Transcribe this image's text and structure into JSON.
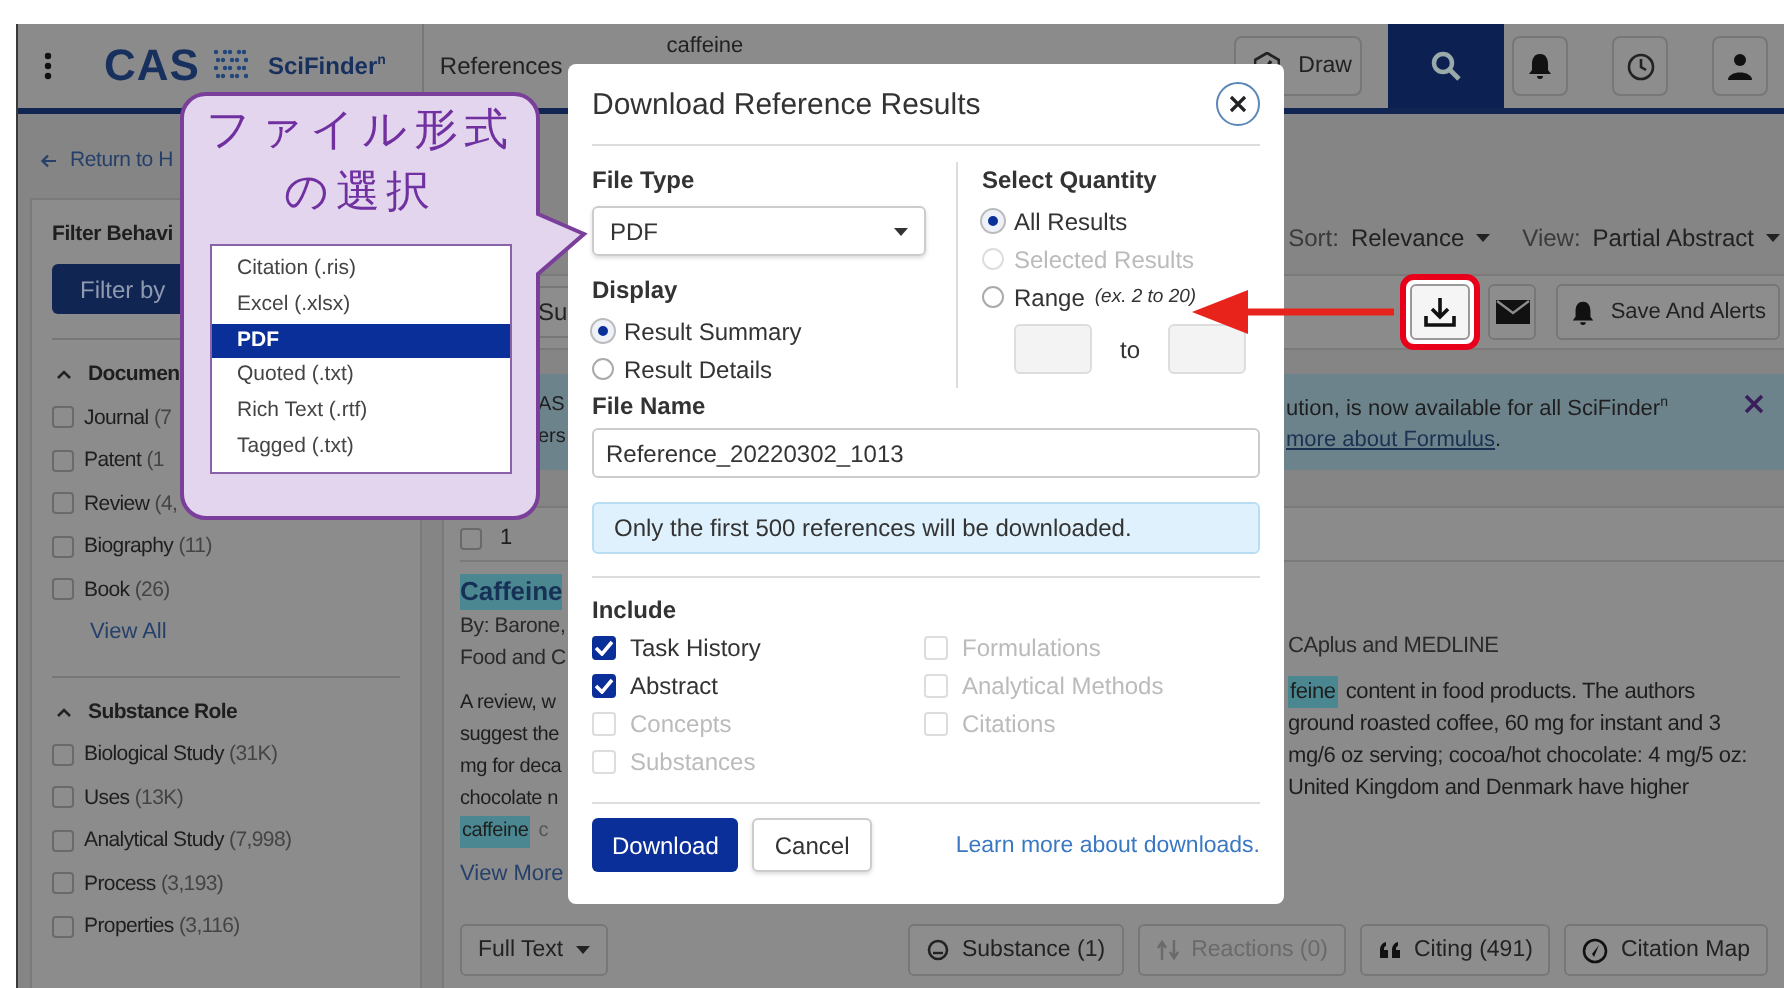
{
  "top_bar": {
    "logo": "CAS",
    "product": "SciFinder$^{n}$",
    "search_type": "References",
    "search_query": "caffeine",
    "draw_button": "Draw"
  },
  "back_link": "Return to H",
  "filter_panel": {
    "title": "Filter Behavi",
    "filter_button": "Filter by",
    "sections": [
      {
        "title": "Documen",
        "expanded": true,
        "items": [
          {
            "label": "Journal",
            "count": "(7",
            "checked": false
          },
          {
            "label": "Patent",
            "count": "(1",
            "checked": false
          },
          {
            "label": "Review",
            "count": "(4,",
            "checked": false
          },
          {
            "label": "Biography",
            "count": "(11)",
            "checked": false
          },
          {
            "label": "Book",
            "count": "(26)",
            "checked": false
          }
        ],
        "view_all": "View All"
      },
      {
        "title": "Substance Role",
        "expanded": true,
        "items": [
          {
            "label": "Biological Study",
            "count": "(31K)",
            "checked": false
          },
          {
            "label": "Uses",
            "count": "(13K)",
            "checked": false
          },
          {
            "label": "Analytical Study",
            "count": "(7,998)",
            "checked": false
          },
          {
            "label": "Process",
            "count": "(3,193)",
            "checked": false
          },
          {
            "label": "Properties",
            "count": "(3,116)",
            "checked": false
          }
        ]
      }
    ]
  },
  "results": {
    "sort_label": "Sort:",
    "sort_value": "Relevance",
    "view_label": "View:",
    "view_value": "Partial Abstract",
    "toolbar_fragment": "Su",
    "save_alerts": "Save And Alerts",
    "banner": {
      "left_lines": [
        "AS",
        "ers"
      ],
      "right_text": "ution, is now available for all SciFinder$^{n}$",
      "link": "more about Formulus",
      "link_end": "."
    },
    "result": {
      "index": "1",
      "checked": false,
      "title": "Caffeine",
      "authors": "By: Barone,",
      "source": "Food and C",
      "database": "CAplus and MEDLINE",
      "abstract_left": [
        {
          "text": "A review, w"
        },
        {
          "text": "suggest the"
        },
        {
          "text": "mg for deca"
        },
        {
          "text": "chocolate n"
        },
        {
          "term": "caffeine",
          "text": "c"
        }
      ],
      "abstract_right": [
        {
          "term": "feine",
          "text": "content in food products. The authors"
        },
        {
          "text": "ground roasted coffee, 60 mg for instant and 3"
        },
        {
          "text": "mg/6 oz serving; cocoa/hot chocolate: 4 mg/5 oz:"
        },
        {
          "text": "United Kingdom and Denmark have higher"
        }
      ],
      "view_more": "View More",
      "full_text": "Full Text",
      "actions": [
        {
          "kind": "substance",
          "label": "Substance (1)",
          "disabled": false
        },
        {
          "kind": "reactions",
          "label": "Reactions (0)",
          "disabled": true
        },
        {
          "kind": "citing",
          "label": "Citing (491)",
          "disabled": false
        },
        {
          "kind": "map",
          "label": "Citation Map",
          "disabled": false
        }
      ]
    }
  },
  "dialog": {
    "title": "Download Reference Results",
    "file_type_label": "File Type",
    "file_type_value": "PDF",
    "display_label": "Display",
    "display_options": [
      {
        "label": "Result Summary",
        "selected": true
      },
      {
        "label": "Result Details",
        "selected": false
      }
    ],
    "quantity_label": "Select Quantity",
    "quantity_options": [
      {
        "label": "All Results",
        "selected": true,
        "disabled": false
      },
      {
        "label": "Selected Results",
        "selected": false,
        "disabled": true
      },
      {
        "label": "Range",
        "hint": "(ex. 2 to 20)",
        "selected": false,
        "disabled": false
      }
    ],
    "range_to": "to",
    "file_name_label": "File Name",
    "file_name": "Reference_20220302_1013",
    "notice": "Only the first 500 references will be downloaded.",
    "include_label": "Include",
    "include_columns": [
      [
        {
          "label": "Task History",
          "checked": true,
          "disabled": false
        },
        {
          "label": "Abstract",
          "checked": true,
          "disabled": false
        },
        {
          "label": "Concepts",
          "checked": false,
          "disabled": true
        },
        {
          "label": "Substances",
          "checked": false,
          "disabled": true
        }
      ],
      [
        {
          "label": "Formulations",
          "checked": false,
          "disabled": true
        },
        {
          "label": "Analytical Methods",
          "checked": false,
          "disabled": true
        },
        {
          "label": "Citations",
          "checked": false,
          "disabled": true
        }
      ]
    ],
    "download_button": "Download",
    "cancel_button": "Cancel",
    "learn_more": "Learn more about downloads."
  },
  "callout": {
    "title_lines": [
      "ファイル形式",
      "の選択"
    ],
    "file_types": [
      {
        "label": "Citation (.ris)",
        "selected": false
      },
      {
        "label": "Excel (.xlsx)",
        "selected": false
      },
      {
        "label": "PDF",
        "selected": true
      },
      {
        "label": "Quoted (.txt)",
        "selected": false
      },
      {
        "label": "Rich Text (.rtf)",
        "selected": false
      },
      {
        "label": "Tagged (.txt)",
        "selected": false
      }
    ]
  }
}
